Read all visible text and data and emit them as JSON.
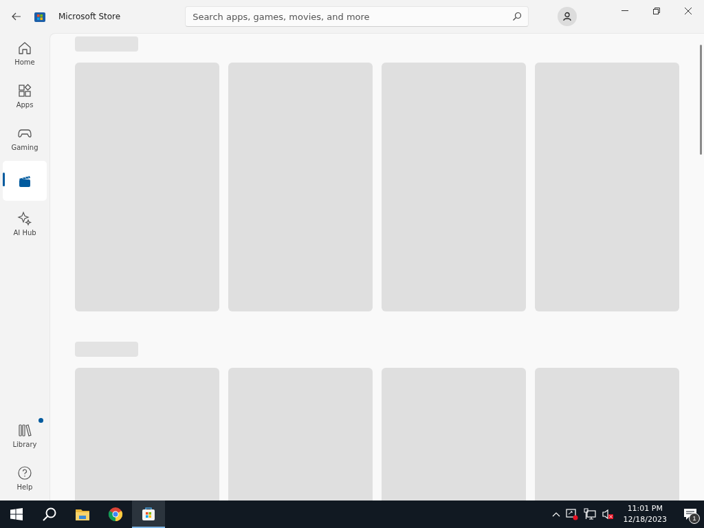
{
  "window": {
    "title": "Microsoft Store"
  },
  "search": {
    "placeholder": "Search apps, games, movies, and more"
  },
  "nav": {
    "items": [
      {
        "label": "Home",
        "selected": false
      },
      {
        "label": "Apps",
        "selected": false
      },
      {
        "label": "Gaming",
        "selected": false
      },
      {
        "selected": true
      },
      {
        "label": "AI Hub",
        "selected": false
      }
    ],
    "bottom_items": [
      {
        "label": "Library",
        "selected": false,
        "notification": true
      },
      {
        "label": "Help",
        "selected": false,
        "notification": false
      }
    ]
  },
  "sections": [
    {
      "kind": "loading",
      "cards": [
        {
          "kind": "loading"
        },
        {
          "kind": "loading"
        },
        {
          "kind": "loading"
        },
        {
          "kind": "loading"
        }
      ]
    },
    {
      "kind": "loading",
      "cards": [
        {
          "kind": "loading"
        },
        {
          "kind": "loading"
        },
        {
          "kind": "loading"
        },
        {
          "kind": "loading"
        }
      ]
    }
  ],
  "taskbar": {
    "apps": [
      {
        "selected": false
      },
      {
        "selected": false
      },
      {
        "selected": false
      },
      {
        "selected": true
      }
    ],
    "time": "11:01 PM",
    "date": "12/18/2023",
    "notification_count": "1"
  }
}
